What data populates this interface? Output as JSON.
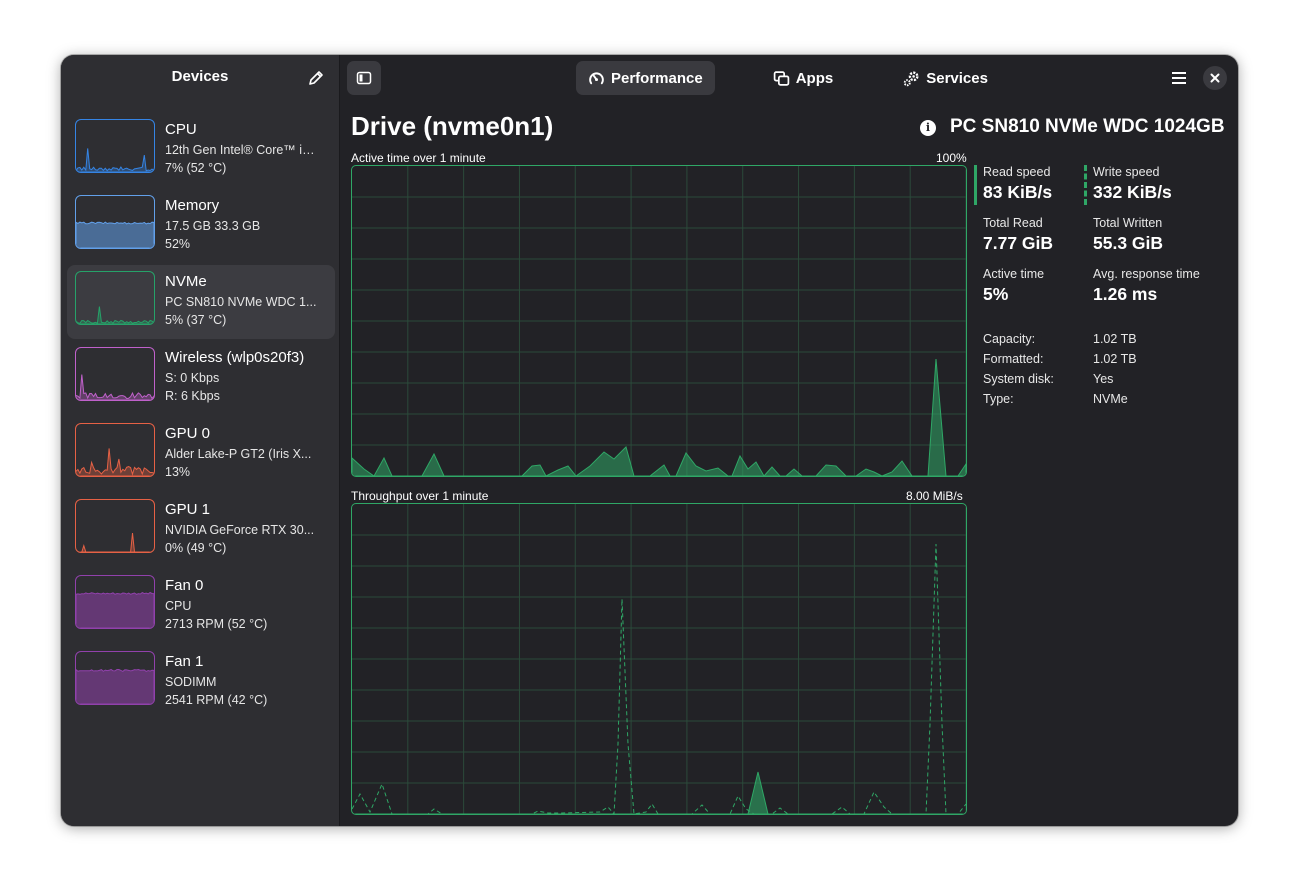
{
  "sidebar": {
    "title": "Devices",
    "devices": [
      {
        "name": "CPU",
        "line1": "12th Gen Intel® Core™ i7-...",
        "line2": "7% (52 °C)",
        "color": "#3584e4",
        "level": 0.07
      },
      {
        "name": "Memory",
        "line1": "17.5 GB 33.3 GB",
        "line2": "52%",
        "color": "#62a0ea",
        "level": 0.52
      },
      {
        "name": "NVMe",
        "line1": "PC SN810 NVMe WDC 1...",
        "line2": "5% (37 °C)",
        "color": "#26a269",
        "level": 0.05
      },
      {
        "name": "Wireless (wlp0s20f3)",
        "line1": "S: 0 Kbps",
        "line2": "R: 6 Kbps",
        "color": "#c061cb",
        "level": 0.1
      },
      {
        "name": "GPU 0",
        "line1": "Alder Lake-P GT2 (Iris X...",
        "line2": "13%",
        "color": "#e66145",
        "level": 0.13
      },
      {
        "name": "GPU 1",
        "line1": "NVIDIA GeForce RTX 30...",
        "line2": "0% (49 °C)",
        "color": "#e66145",
        "level": 0.0
      },
      {
        "name": "Fan 0",
        "line1": "CPU",
        "line2": "2713 RPM (52 °C)",
        "color": "#9141ac",
        "level": 0.72
      },
      {
        "name": "Fan 1",
        "line1": "SODIMM",
        "line2": "2541 RPM (42 °C)",
        "color": "#9141ac",
        "level": 0.7
      }
    ],
    "selected_index": 2
  },
  "tabs": [
    {
      "label": "Performance",
      "icon": "gauge-icon",
      "active": true
    },
    {
      "label": "Apps",
      "icon": "apps-icon",
      "active": false
    },
    {
      "label": "Services",
      "icon": "services-icon",
      "active": false
    }
  ],
  "main": {
    "title": "Drive (nvme0n1)",
    "model": "PC SN810 NVMe WDC 1024GB",
    "active_graph": {
      "label": "Active time over 1 minute",
      "max": "100%"
    },
    "throughput_graph": {
      "label": "Throughput over 1 minute",
      "max": "8.00 MiB/s"
    },
    "stats": {
      "read_speed_label": "Read speed",
      "read_speed": "83 KiB/s",
      "write_speed_label": "Write speed",
      "write_speed": "332 KiB/s",
      "total_read_label": "Total Read",
      "total_read": "7.77 GiB",
      "total_written_label": "Total Written",
      "total_written": "55.3 GiB",
      "active_time_label": "Active time",
      "active_time": "5%",
      "avg_response_label": "Avg. response time",
      "avg_response": "1.26 ms"
    },
    "properties": [
      {
        "key": "Capacity:",
        "value": "1.02 TB"
      },
      {
        "key": "Formatted:",
        "value": "1.02 TB"
      },
      {
        "key": "System disk:",
        "value": "Yes"
      },
      {
        "key": "Type:",
        "value": "NVMe"
      }
    ]
  },
  "accent": "#2fa766"
}
